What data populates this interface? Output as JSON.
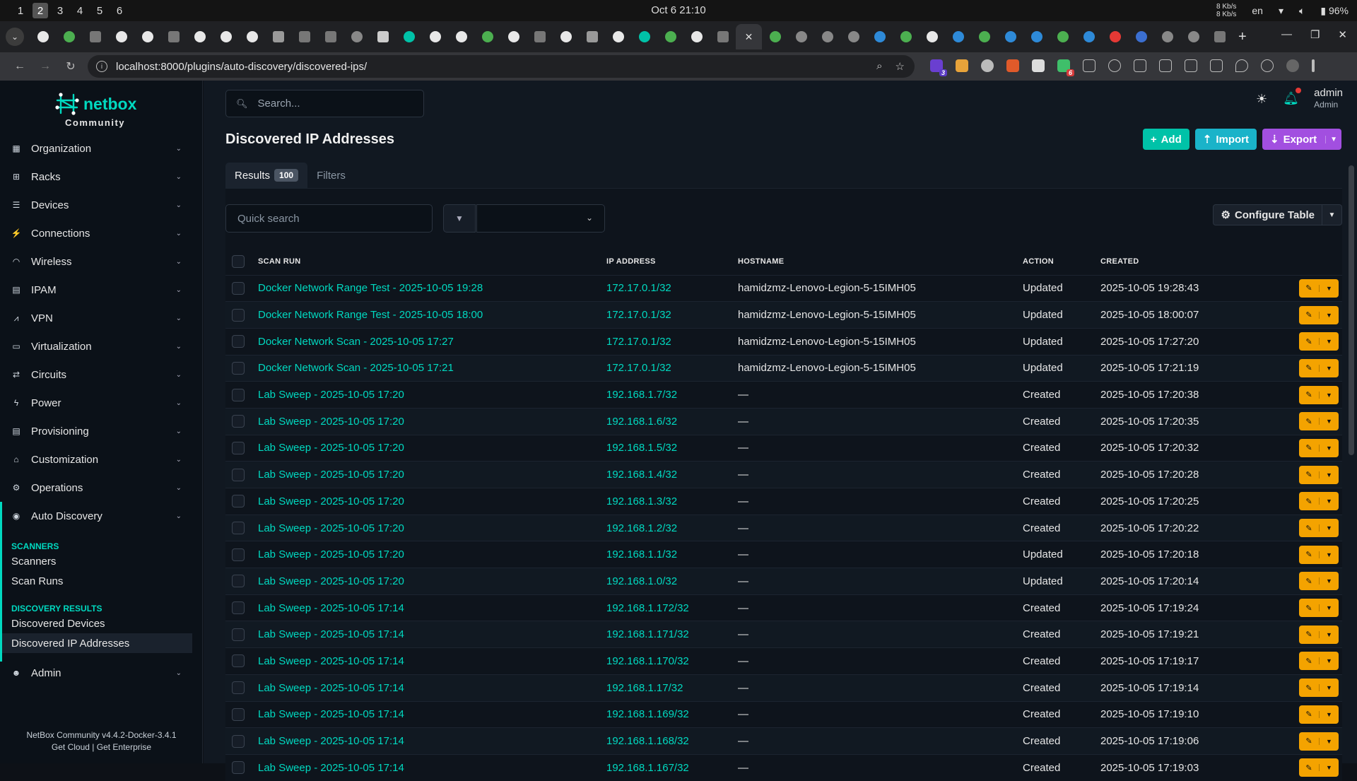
{
  "os": {
    "workspaces": [
      "1",
      "2",
      "3",
      "4",
      "5",
      "6"
    ],
    "active_workspace": "2",
    "clock": "Oct 6  21:10",
    "net_up": "8 Kb/s",
    "net_down": "8 Kb/s",
    "lang": "en",
    "battery": "96%"
  },
  "browser": {
    "url": "localhost:8000/plugins/auto-discovery/discovered-ips/",
    "close_glyph": "✕",
    "newtab_glyph": "+",
    "ext_badge_1": "3",
    "ext_badge_2": "6"
  },
  "sidebar": {
    "brand": "netbox",
    "brand_sub": "Community",
    "menu": [
      {
        "label": "Organization",
        "icon": "building-icon"
      },
      {
        "label": "Racks",
        "icon": "rack-icon"
      },
      {
        "label": "Devices",
        "icon": "server-icon"
      },
      {
        "label": "Connections",
        "icon": "plug-icon"
      },
      {
        "label": "Wireless",
        "icon": "wifi-icon"
      },
      {
        "label": "IPAM",
        "icon": "counter-icon"
      },
      {
        "label": "VPN",
        "icon": "tunnel-icon"
      },
      {
        "label": "Virtualization",
        "icon": "monitor-icon"
      },
      {
        "label": "Circuits",
        "icon": "transit-icon"
      },
      {
        "label": "Power",
        "icon": "flash-icon"
      },
      {
        "label": "Provisioning",
        "icon": "file-icon"
      },
      {
        "label": "Customization",
        "icon": "toolbox-icon"
      },
      {
        "label": "Operations",
        "icon": "cogs-icon"
      },
      {
        "label": "Auto Discovery",
        "icon": "radar-icon"
      }
    ],
    "scanners_header": "SCANNERS",
    "scanners_items": [
      "Scanners",
      "Scan Runs"
    ],
    "results_header": "DISCOVERY RESULTS",
    "results_items": [
      "Discovered Devices",
      "Discovered IP Addresses"
    ],
    "admin_label": "Admin",
    "footer_version": "NetBox Community v4.4.2-Docker-3.4.1",
    "footer_cloud": "Get Cloud",
    "footer_sep": "|",
    "footer_enterprise": "Get Enterprise"
  },
  "header": {
    "search_placeholder": "Search...",
    "username": "admin",
    "role": "Admin"
  },
  "page": {
    "title": "Discovered IP Addresses",
    "add_label": "Add",
    "import_label": "Import",
    "export_label": "Export",
    "tab_results": "Results",
    "tab_results_count": "100",
    "tab_filters": "Filters",
    "quick_search_placeholder": "Quick search",
    "configure_table": "Configure Table"
  },
  "table": {
    "columns": [
      "SCAN RUN",
      "IP ADDRESS",
      "HOSTNAME",
      "ACTION",
      "CREATED"
    ],
    "rows": [
      [
        "Docker Network Range Test - 2025-10-05 19:28",
        "172.17.0.1/32",
        "hamidzmz-Lenovo-Legion-5-15IMH05",
        "Updated",
        "2025-10-05 19:28:43"
      ],
      [
        "Docker Network Range Test - 2025-10-05 18:00",
        "172.17.0.1/32",
        "hamidzmz-Lenovo-Legion-5-15IMH05",
        "Updated",
        "2025-10-05 18:00:07"
      ],
      [
        "Docker Network Scan - 2025-10-05 17:27",
        "172.17.0.1/32",
        "hamidzmz-Lenovo-Legion-5-15IMH05",
        "Updated",
        "2025-10-05 17:27:20"
      ],
      [
        "Docker Network Scan - 2025-10-05 17:21",
        "172.17.0.1/32",
        "hamidzmz-Lenovo-Legion-5-15IMH05",
        "Updated",
        "2025-10-05 17:21:19"
      ],
      [
        "Lab Sweep - 2025-10-05 17:20",
        "192.168.1.7/32",
        "—",
        "Created",
        "2025-10-05 17:20:38"
      ],
      [
        "Lab Sweep - 2025-10-05 17:20",
        "192.168.1.6/32",
        "—",
        "Created",
        "2025-10-05 17:20:35"
      ],
      [
        "Lab Sweep - 2025-10-05 17:20",
        "192.168.1.5/32",
        "—",
        "Created",
        "2025-10-05 17:20:32"
      ],
      [
        "Lab Sweep - 2025-10-05 17:20",
        "192.168.1.4/32",
        "—",
        "Created",
        "2025-10-05 17:20:28"
      ],
      [
        "Lab Sweep - 2025-10-05 17:20",
        "192.168.1.3/32",
        "—",
        "Created",
        "2025-10-05 17:20:25"
      ],
      [
        "Lab Sweep - 2025-10-05 17:20",
        "192.168.1.2/32",
        "—",
        "Created",
        "2025-10-05 17:20:22"
      ],
      [
        "Lab Sweep - 2025-10-05 17:20",
        "192.168.1.1/32",
        "—",
        "Updated",
        "2025-10-05 17:20:18"
      ],
      [
        "Lab Sweep - 2025-10-05 17:20",
        "192.168.1.0/32",
        "—",
        "Updated",
        "2025-10-05 17:20:14"
      ],
      [
        "Lab Sweep - 2025-10-05 17:14",
        "192.168.1.172/32",
        "—",
        "Created",
        "2025-10-05 17:19:24"
      ],
      [
        "Lab Sweep - 2025-10-05 17:14",
        "192.168.1.171/32",
        "—",
        "Created",
        "2025-10-05 17:19:21"
      ],
      [
        "Lab Sweep - 2025-10-05 17:14",
        "192.168.1.170/32",
        "—",
        "Created",
        "2025-10-05 17:19:17"
      ],
      [
        "Lab Sweep - 2025-10-05 17:14",
        "192.168.1.17/32",
        "—",
        "Created",
        "2025-10-05 17:19:14"
      ],
      [
        "Lab Sweep - 2025-10-05 17:14",
        "192.168.1.169/32",
        "—",
        "Created",
        "2025-10-05 17:19:10"
      ],
      [
        "Lab Sweep - 2025-10-05 17:14",
        "192.168.1.168/32",
        "—",
        "Created",
        "2025-10-05 17:19:06"
      ],
      [
        "Lab Sweep - 2025-10-05 17:14",
        "192.168.1.167/32",
        "—",
        "Created",
        "2025-10-05 17:19:03"
      ]
    ]
  },
  "colors": {
    "accent": "#00d9c0",
    "add": "#00c2a8",
    "import": "#1ab3c9",
    "export": "#a24fe0",
    "edit": "#f4a300"
  },
  "browser_favicons": [
    "github",
    "chrome",
    "grid",
    "github",
    "github",
    "grid",
    "github",
    "github",
    "github",
    "helm",
    "grid",
    "grid",
    "globe",
    "bot",
    "branch",
    "github",
    "github",
    "chrome",
    "github",
    "grid",
    "github",
    "helm",
    "github",
    "branch",
    "chrome",
    "github",
    "grid",
    "active",
    "chrome",
    "globe",
    "globe",
    "globe",
    "edge",
    "chrome",
    "github",
    "edge",
    "chrome",
    "edge",
    "edge",
    "chrome",
    "edge",
    "youtube",
    "mail",
    "globe",
    "globe",
    "grid"
  ]
}
